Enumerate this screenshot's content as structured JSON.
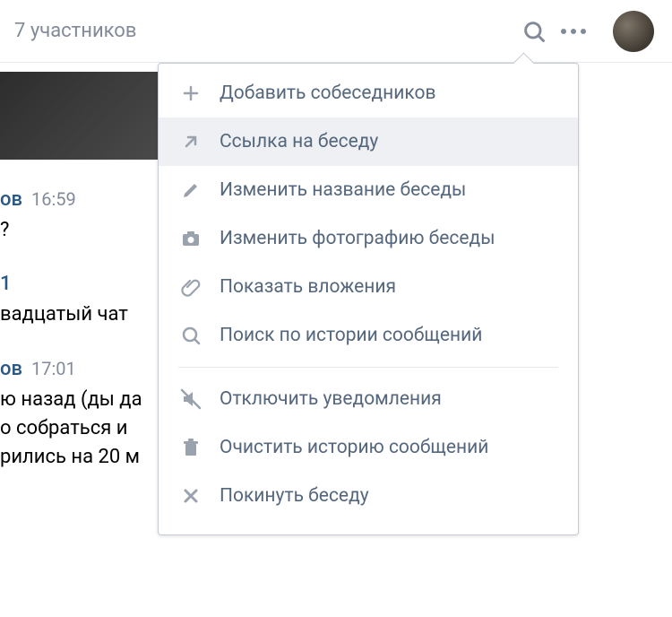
{
  "header": {
    "participants_label": "7 участников"
  },
  "messages": [
    {
      "name_suffix": "ов",
      "time": "16:59",
      "lines": [
        "?"
      ]
    },
    {
      "name_suffix": "1",
      "time": "",
      "lines": [
        "вадцатый чат"
      ]
    },
    {
      "name_suffix": "ов",
      "time": "17:01",
      "lines": [
        "ю назад (ды да",
        "о собраться и",
        "рились на 20 м"
      ]
    }
  ],
  "menu": {
    "items": [
      {
        "icon": "plus-icon",
        "label": "Добавить собеседников",
        "hover": false
      },
      {
        "icon": "arrow-out-icon",
        "label": "Ссылка на беседу",
        "hover": true
      },
      {
        "icon": "pencil-icon",
        "label": "Изменить название беседы",
        "hover": false
      },
      {
        "icon": "camera-icon",
        "label": "Изменить фотографию беседы",
        "hover": false
      },
      {
        "icon": "attachment-icon",
        "label": "Показать вложения",
        "hover": false
      },
      {
        "icon": "search-icon",
        "label": "Поиск по истории сообщений",
        "hover": false
      }
    ],
    "items2": [
      {
        "icon": "mute-icon",
        "label": "Отключить уведомления",
        "hover": false
      },
      {
        "icon": "trash-icon",
        "label": "Очистить историю сообщений",
        "hover": false
      },
      {
        "icon": "close-icon",
        "label": "Покинуть беседу",
        "hover": false
      }
    ]
  }
}
